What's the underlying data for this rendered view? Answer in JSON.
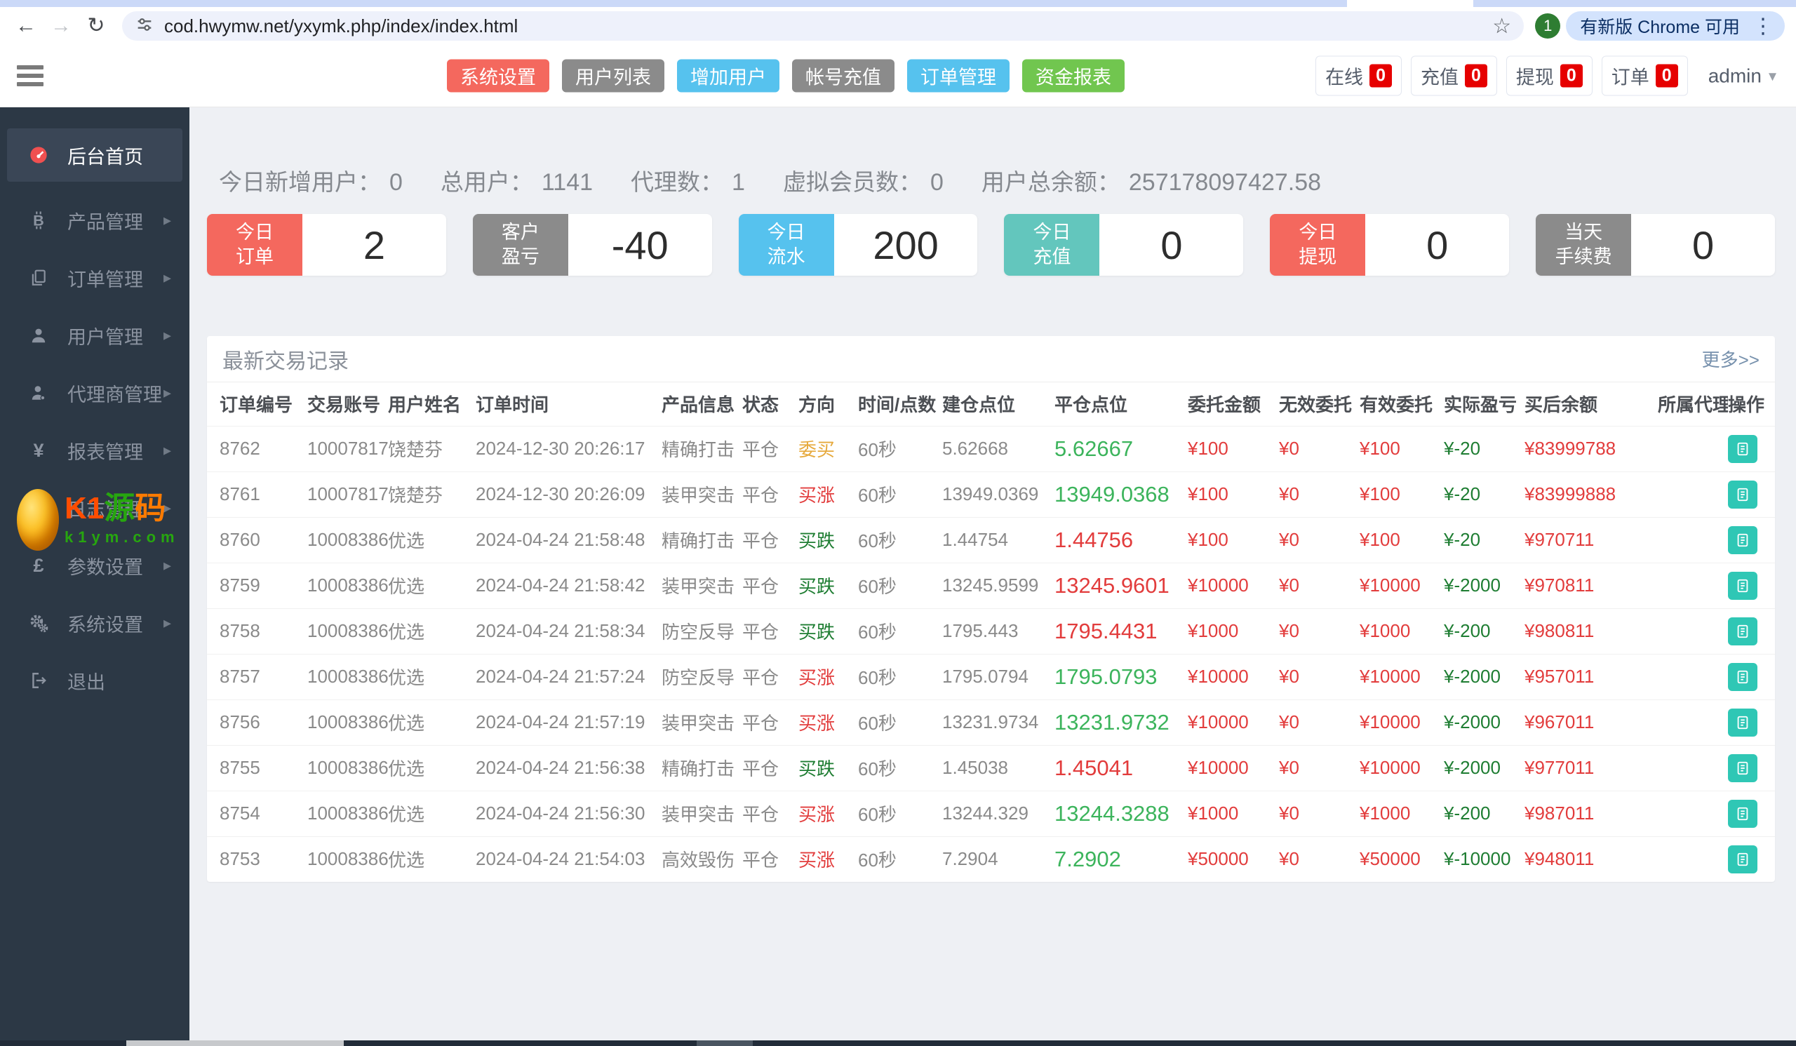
{
  "palette": {
    "red": "#e23c3c",
    "up_green": "#3cb45c",
    "profit_green": "#1e7d32",
    "orange": "#e6a93c",
    "link_blue": "#7791ad"
  },
  "icons": {
    "back": "←",
    "forward": "→",
    "reload": "↻",
    "star": "☆",
    "kebab": "⋮",
    "caret": "▾",
    "chevron": "▸"
  },
  "browser": {
    "url": "cod.hwymw.net/yxymk.php/index/index.html",
    "profile_badge": "1",
    "update_button": "有新版 Chrome 可用"
  },
  "header": {
    "nav_buttons": [
      {
        "id": "system-settings",
        "label": "系统设置",
        "color": "#f4685e"
      },
      {
        "id": "user-list",
        "label": "用户列表",
        "color": "#8b8b8b"
      },
      {
        "id": "add-user",
        "label": "增加用户",
        "color": "#56c2ee"
      },
      {
        "id": "account-recharge",
        "label": "帐号充值",
        "color": "#8b8b8b"
      },
      {
        "id": "order-management",
        "label": "订单管理",
        "color": "#56c2ee"
      },
      {
        "id": "funds-report",
        "label": "资金报表",
        "color": "#71c64f"
      }
    ],
    "counters": [
      {
        "id": "online",
        "label": "在线",
        "value": "0"
      },
      {
        "id": "recharge",
        "label": "充值",
        "value": "0"
      },
      {
        "id": "withdraw",
        "label": "提现",
        "value": "0"
      },
      {
        "id": "orders",
        "label": "订单",
        "value": "0"
      }
    ],
    "user": "admin"
  },
  "sidebar": {
    "items": [
      {
        "id": "dashboard",
        "label": "后台首页",
        "icon": "gauge",
        "active": true,
        "arrow": false
      },
      {
        "id": "product",
        "label": "产品管理",
        "icon": "bitcoin",
        "active": false,
        "arrow": true
      },
      {
        "id": "order",
        "label": "订单管理",
        "icon": "files",
        "active": false,
        "arrow": true
      },
      {
        "id": "user",
        "label": "用户管理",
        "icon": "user",
        "active": false,
        "arrow": true
      },
      {
        "id": "agent",
        "label": "代理商管理",
        "icon": "agent",
        "active": false,
        "arrow": true
      },
      {
        "id": "report",
        "label": "报表管理",
        "icon": "yen",
        "active": false,
        "arrow": true
      },
      {
        "id": "log",
        "label": "日志管理",
        "icon": "log",
        "active": false,
        "arrow": true
      },
      {
        "id": "params",
        "label": "参数设置",
        "icon": "pound",
        "active": false,
        "arrow": true
      },
      {
        "id": "system",
        "label": "系统设置",
        "icon": "gears",
        "active": false,
        "arrow": true
      },
      {
        "id": "logout",
        "label": "退出",
        "icon": "logout",
        "active": false,
        "arrow": false
      }
    ],
    "watermark": {
      "k1": "K1",
      "yuan": "源",
      "ma": "码",
      "domain": "k1ym.com"
    }
  },
  "stats": [
    {
      "label": "今日新增用户：",
      "value": "0"
    },
    {
      "label": "总用户：",
      "value": "1141"
    },
    {
      "label": "代理数：",
      "value": "1"
    },
    {
      "label": "虚拟会员数：",
      "value": "0"
    },
    {
      "label": "用户总余额：",
      "value": "257178097427.58"
    }
  ],
  "cards": [
    {
      "id": "today-orders",
      "line1": "今日",
      "line2": "订单",
      "value": "2",
      "color": "#f4685e"
    },
    {
      "id": "customer-pnl",
      "line1": "客户",
      "line2": "盈亏",
      "value": "-40",
      "color": "#8b8b8b"
    },
    {
      "id": "today-flow",
      "line1": "今日",
      "line2": "流水",
      "value": "200",
      "color": "#56c2ee"
    },
    {
      "id": "today-recharge",
      "line1": "今日",
      "line2": "充值",
      "value": "0",
      "color": "#63c6bd"
    },
    {
      "id": "today-withdraw",
      "line1": "今日",
      "line2": "提现",
      "value": "0",
      "color": "#f4685e"
    },
    {
      "id": "today-fee",
      "line1": "当天",
      "line2": "手续费",
      "value": "0",
      "color": "#8b8b8b"
    }
  ],
  "table": {
    "title": "最新交易记录",
    "more": "更多>>",
    "headers": [
      "订单编号",
      "交易账号",
      "用户姓名",
      "订单时间",
      "产品信息",
      "状态",
      "方向",
      "时间/点数",
      "建仓点位",
      "平仓点位",
      "委托金额",
      "无效委托",
      "有效委托",
      "实际盈亏",
      "买后余额",
      "所属代理",
      "操作"
    ],
    "rows": [
      {
        "order_id": "8762",
        "account": "10007817",
        "name": "饶楚芬",
        "time": "2024-12-30 20:26:17",
        "product": "精确打击",
        "status": "平仓",
        "direction": "委买",
        "direction_color": "orange",
        "duration": "60秒",
        "open": "5.62668",
        "close": "5.62667",
        "close_color": "green",
        "amount": "¥100",
        "invalid": "¥0",
        "valid": "¥100",
        "profit": "¥-20",
        "balance": "¥83999788",
        "agent": ""
      },
      {
        "order_id": "8761",
        "account": "10007817",
        "name": "饶楚芬",
        "time": "2024-12-30 20:26:09",
        "product": "装甲突击",
        "status": "平仓",
        "direction": "买涨",
        "direction_color": "red",
        "duration": "60秒",
        "open": "13949.0369",
        "close": "13949.0368",
        "close_color": "green",
        "amount": "¥100",
        "invalid": "¥0",
        "valid": "¥100",
        "profit": "¥-20",
        "balance": "¥83999888",
        "agent": ""
      },
      {
        "order_id": "8760",
        "account": "10008386",
        "name": "优选",
        "time": "2024-04-24 21:58:48",
        "product": "精确打击",
        "status": "平仓",
        "direction": "买跌",
        "direction_color": "green",
        "duration": "60秒",
        "open": "1.44754",
        "close": "1.44756",
        "close_color": "red",
        "amount": "¥100",
        "invalid": "¥0",
        "valid": "¥100",
        "profit": "¥-20",
        "balance": "¥970711",
        "agent": ""
      },
      {
        "order_id": "8759",
        "account": "10008386",
        "name": "优选",
        "time": "2024-04-24 21:58:42",
        "product": "装甲突击",
        "status": "平仓",
        "direction": "买跌",
        "direction_color": "green",
        "duration": "60秒",
        "open": "13245.9599",
        "close": "13245.9601",
        "close_color": "red",
        "amount": "¥10000",
        "invalid": "¥0",
        "valid": "¥10000",
        "profit": "¥-2000",
        "balance": "¥970811",
        "agent": ""
      },
      {
        "order_id": "8758",
        "account": "10008386",
        "name": "优选",
        "time": "2024-04-24 21:58:34",
        "product": "防空反导",
        "status": "平仓",
        "direction": "买跌",
        "direction_color": "green",
        "duration": "60秒",
        "open": "1795.443",
        "close": "1795.4431",
        "close_color": "red",
        "amount": "¥1000",
        "invalid": "¥0",
        "valid": "¥1000",
        "profit": "¥-200",
        "balance": "¥980811",
        "agent": ""
      },
      {
        "order_id": "8757",
        "account": "10008386",
        "name": "优选",
        "time": "2024-04-24 21:57:24",
        "product": "防空反导",
        "status": "平仓",
        "direction": "买涨",
        "direction_color": "red",
        "duration": "60秒",
        "open": "1795.0794",
        "close": "1795.0793",
        "close_color": "green",
        "amount": "¥10000",
        "invalid": "¥0",
        "valid": "¥10000",
        "profit": "¥-2000",
        "balance": "¥957011",
        "agent": ""
      },
      {
        "order_id": "8756",
        "account": "10008386",
        "name": "优选",
        "time": "2024-04-24 21:57:19",
        "product": "装甲突击",
        "status": "平仓",
        "direction": "买涨",
        "direction_color": "red",
        "duration": "60秒",
        "open": "13231.9734",
        "close": "13231.9732",
        "close_color": "green",
        "amount": "¥10000",
        "invalid": "¥0",
        "valid": "¥10000",
        "profit": "¥-2000",
        "balance": "¥967011",
        "agent": ""
      },
      {
        "order_id": "8755",
        "account": "10008386",
        "name": "优选",
        "time": "2024-04-24 21:56:38",
        "product": "精确打击",
        "status": "平仓",
        "direction": "买跌",
        "direction_color": "green",
        "duration": "60秒",
        "open": "1.45038",
        "close": "1.45041",
        "close_color": "red",
        "amount": "¥10000",
        "invalid": "¥0",
        "valid": "¥10000",
        "profit": "¥-2000",
        "balance": "¥977011",
        "agent": ""
      },
      {
        "order_id": "8754",
        "account": "10008386",
        "name": "优选",
        "time": "2024-04-24 21:56:30",
        "product": "装甲突击",
        "status": "平仓",
        "direction": "买涨",
        "direction_color": "red",
        "duration": "60秒",
        "open": "13244.329",
        "close": "13244.3288",
        "close_color": "green",
        "amount": "¥1000",
        "invalid": "¥0",
        "valid": "¥1000",
        "profit": "¥-200",
        "balance": "¥987011",
        "agent": ""
      },
      {
        "order_id": "8753",
        "account": "10008386",
        "name": "优选",
        "time": "2024-04-24 21:54:03",
        "product": "高效毁伤",
        "status": "平仓",
        "direction": "买涨",
        "direction_color": "red",
        "duration": "60秒",
        "open": "7.2904",
        "close": "7.2902",
        "close_color": "green",
        "amount": "¥50000",
        "invalid": "¥0",
        "valid": "¥50000",
        "profit": "¥-10000",
        "balance": "¥948011",
        "agent": ""
      }
    ]
  }
}
